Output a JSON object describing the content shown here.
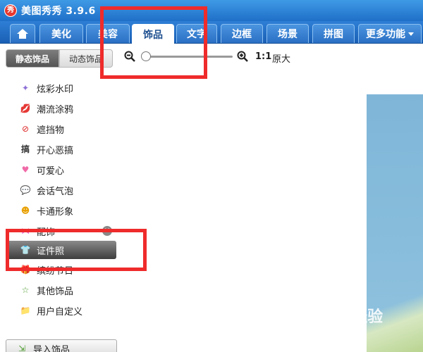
{
  "app": {
    "logo_text": "秀",
    "title": "美图秀秀 3.9.6"
  },
  "tabs": [
    {
      "label": ""
    },
    {
      "label": "美化"
    },
    {
      "label": "美容"
    },
    {
      "label": "饰品"
    },
    {
      "label": "文字"
    },
    {
      "label": "边框"
    },
    {
      "label": "场景"
    },
    {
      "label": "拼图"
    },
    {
      "label": "更多功能"
    }
  ],
  "active_tab": "饰品",
  "subtabs": {
    "static": "静态饰品",
    "dynamic": "动态饰品"
  },
  "categories": [
    {
      "label": "炫彩水印",
      "icon": "sparkle-icon",
      "glyph": "✦"
    },
    {
      "label": "潮流涂鸦",
      "icon": "lips-icon",
      "glyph": "💋"
    },
    {
      "label": "遮挡物",
      "icon": "no-sign-icon",
      "glyph": "⊘"
    },
    {
      "label": "开心恶搞",
      "icon": "funny-text-icon",
      "glyph": "搞"
    },
    {
      "label": "可爱心",
      "icon": "heart-icon",
      "glyph": "♥"
    },
    {
      "label": "会话气泡",
      "icon": "speech-bubble-icon",
      "glyph": "💬"
    },
    {
      "label": "卡通形象",
      "icon": "cartoon-face-icon",
      "glyph": "☻"
    },
    {
      "label": "配饰",
      "icon": "bow-icon",
      "glyph": "⋈"
    },
    {
      "label": "证件照",
      "icon": "shirt-icon",
      "glyph": "👕"
    },
    {
      "label": "缤纷节日",
      "icon": "gift-icon",
      "glyph": "🎁"
    },
    {
      "label": "其他饰品",
      "icon": "star-icon",
      "glyph": "☆"
    },
    {
      "label": "用户自定义",
      "icon": "folder-icon",
      "glyph": "📁"
    }
  ],
  "selected_category": "证件照",
  "import_button": "导入饰品",
  "zoom": {
    "ratio": "1:1",
    "original_size_label": "原大",
    "level_fraction": 0.0
  },
  "watermark_text": "Bai经验",
  "colors": {
    "title_bar": "#1f6fc8",
    "highlight": "#ef2b2b"
  }
}
